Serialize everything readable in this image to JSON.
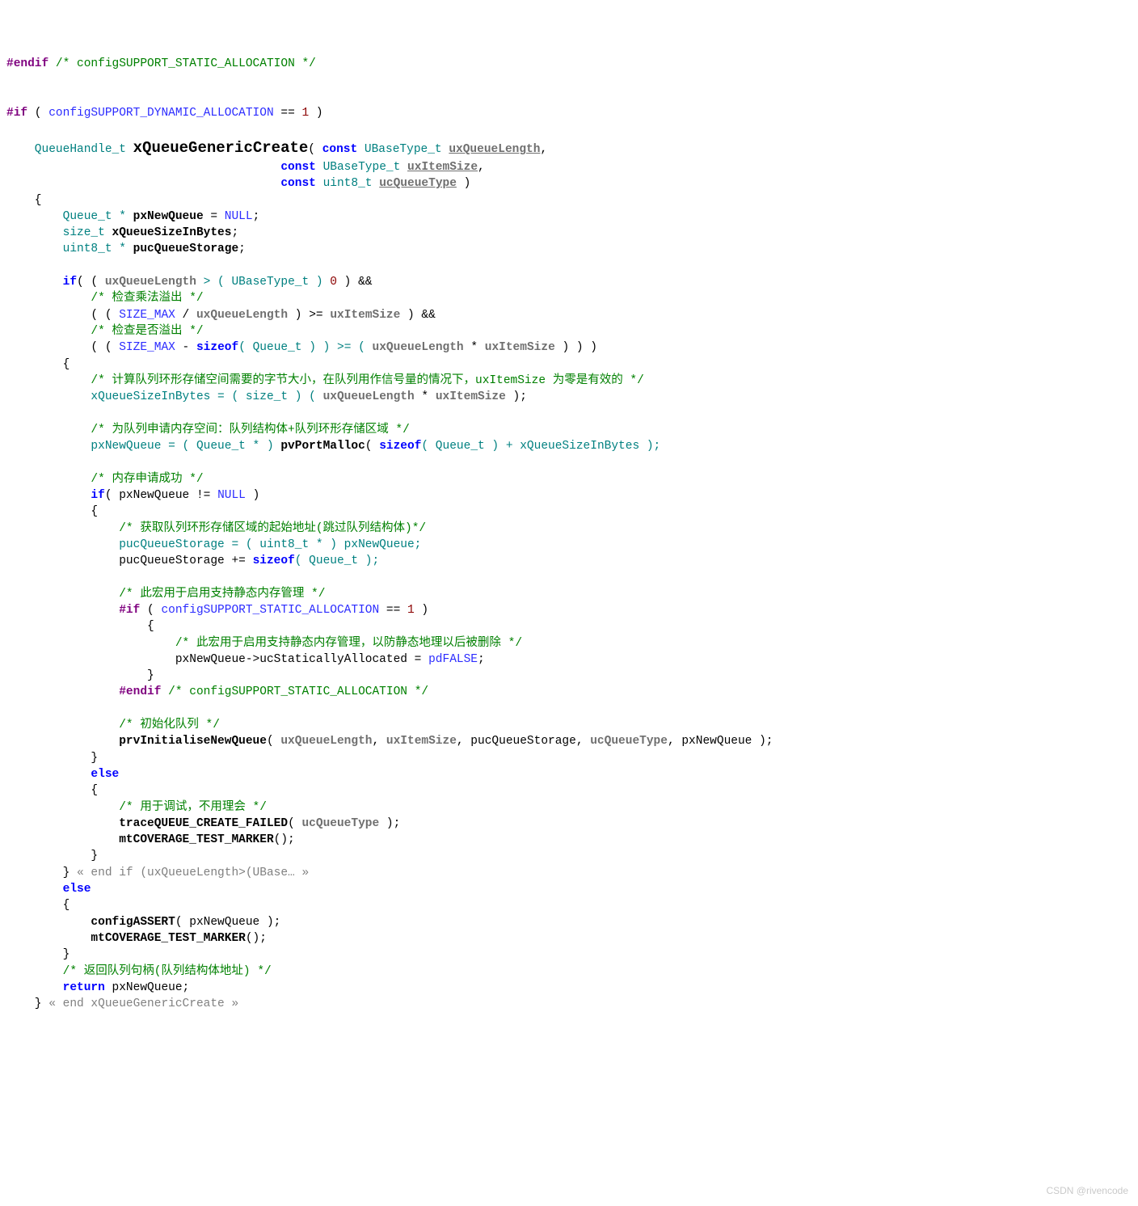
{
  "watermark": "CSDN @rivencode",
  "code": {
    "l01a": "#endif",
    "l01b": " /* configSUPPORT_STATIC_ALLOCATION */",
    "blank1": "",
    "blank2": "",
    "l04a": "#if",
    "l04b": " ( ",
    "l04c": "configSUPPORT_DYNAMIC_ALLOCATION",
    "l04d": " == ",
    "l04e": "1",
    "l04f": " )",
    "blank3": "",
    "l06a": "    QueueHandle_t ",
    "l06b": "xQueueGenericCreate",
    "l06c": "( ",
    "l06d": "const",
    "l06e": " UBaseType_t ",
    "l06f": "uxQueueLength",
    "l06g": ",",
    "l07a": "                                       ",
    "l07b": "const",
    "l07c": " UBaseType_t ",
    "l07d": "uxItemSize",
    "l07e": ",",
    "l08a": "                                       ",
    "l08b": "const",
    "l08c": " uint8_t ",
    "l08d": "ucQueueType",
    "l08e": " )",
    "l09": "    {",
    "l10a": "        Queue_t * ",
    "l10b": "pxNewQueue",
    "l10c": " = ",
    "l10d": "NULL",
    "l10e": ";",
    "l11a": "        size_t ",
    "l11b": "xQueueSizeInBytes",
    "l11c": ";",
    "l12a": "        uint8_t * ",
    "l12b": "pucQueueStorage",
    "l12c": ";",
    "blank4": "",
    "l14a": "        if",
    "l14b": "( ( ",
    "l14c": "uxQueueLength",
    "l14d": " > ( UBaseType_t ) ",
    "l14e": "0",
    "l14f": " ) &&",
    "l15": "            /* 检查乘法溢出 */",
    "l16a": "            ( ( ",
    "l16b": "SIZE_MAX",
    "l16c": " / ",
    "l16d": "uxQueueLength",
    "l16e": " ) >= ",
    "l16f": "uxItemSize",
    "l16g": " ) &&",
    "l17": "            /* 检查是否溢出 */",
    "l18a": "            ( ( ",
    "l18b": "SIZE_MAX",
    "l18c": " - ",
    "l18d": "sizeof",
    "l18e": "( Queue_t ) ) >= ( ",
    "l18f": "uxQueueLength",
    "l18g": " * ",
    "l18h": "uxItemSize",
    "l18i": " ) ) )",
    "l19": "        {",
    "l20": "            /* 计算队列环形存储空间需要的字节大小，在队列用作信号量的情况下，uxItemSize 为零是有效的 */",
    "l21a": "            xQueueSizeInBytes = ( size_t ) ( ",
    "l21b": "uxQueueLength",
    "l21c": " * ",
    "l21d": "uxItemSize",
    "l21e": " );",
    "blank5": "",
    "l23": "            /* 为队列申请内存空间：队列结构体+队列环形存储区域 */",
    "l24a": "            pxNewQueue = ( Queue_t * ) ",
    "l24b": "pvPortMalloc",
    "l24c": "( ",
    "l24d": "sizeof",
    "l24e": "( Queue_t ) + xQueueSizeInBytes );",
    "blank6": "",
    "l26": "            /* 内存申请成功 */",
    "l27a": "            if",
    "l27b": "( pxNewQueue != ",
    "l27c": "NULL",
    "l27d": " )",
    "l28": "            {",
    "l29": "                /* 获取队列环形存储区域的起始地址(跳过队列结构体)*/",
    "l30": "                pucQueueStorage = ( uint8_t * ) pxNewQueue;",
    "l31a": "                pucQueueStorage += ",
    "l31b": "sizeof",
    "l31c": "( Queue_t );",
    "blank7": "",
    "l33": "                /* 此宏用于启用支持静态内存管理 */",
    "l34a": "                #if",
    "l34b": " ( ",
    "l34c": "configSUPPORT_STATIC_ALLOCATION",
    "l34d": " == ",
    "l34e": "1",
    "l34f": " )",
    "l35": "                    {",
    "l36": "                        /* 此宏用于启用支持静态内存管理，以防静态地理以后被删除 */",
    "l37a": "                        pxNewQueue->ucStaticallyAllocated = ",
    "l37b": "pdFALSE",
    "l37c": ";",
    "l38": "                    }",
    "l39a": "                #endif",
    "l39b": " /* configSUPPORT_STATIC_ALLOCATION */",
    "blank8": "",
    "l41": "                /* 初始化队列 */",
    "l42a": "                prvInitialiseNewQueue",
    "l42b": "( ",
    "l42c": "uxQueueLength",
    "l42d": ", ",
    "l42e": "uxItemSize",
    "l42f": ", pucQueueStorage, ",
    "l42g": "ucQueueType",
    "l42h": ", pxNewQueue );",
    "l43": "            }",
    "l44a": "            else",
    "l45": "            {",
    "l46": "                /* 用于调试，不用理会 */",
    "l47a": "                traceQUEUE_CREATE_FAILED",
    "l47b": "( ",
    "l47c": "ucQueueType",
    "l47d": " );",
    "l48a": "                mtCOVERAGE_TEST_MARKER",
    "l48b": "();",
    "l49": "            }",
    "l50a": "        } ",
    "l50b": "« end if (uxQueueLength>(UBase… »",
    "l51a": "        else",
    "l52": "        {",
    "l53a": "            configASSERT",
    "l53b": "( pxNewQueue );",
    "l54a": "            mtCOVERAGE_TEST_MARKER",
    "l54b": "();",
    "l55": "        }",
    "l56": "        /* 返回队列句柄(队列结构体地址) */",
    "l57a": "        return",
    "l57b": " pxNewQueue;",
    "l58a": "    } ",
    "l58b": "« end xQueueGenericCreate »"
  }
}
